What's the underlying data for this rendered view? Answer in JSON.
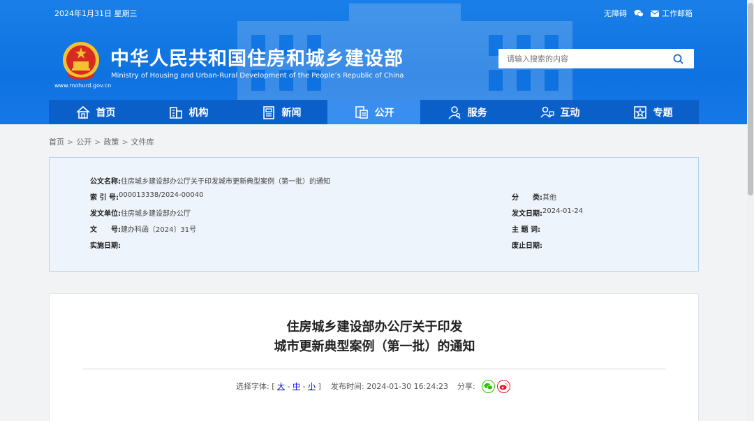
{
  "topbar": {
    "date": "2024年1月31日 星期三",
    "accessibility": "无障碍",
    "mail": "工作邮箱"
  },
  "site": {
    "title_cn": "中华人民共和国住房和城乡建设部",
    "title_en": "Ministry of Housing and Urban-Rural Development of the People’s Republic of China",
    "url": "www.mohurd.gov.cn"
  },
  "search": {
    "placeholder": "请输入搜索的内容"
  },
  "nav": [
    {
      "label": "首页",
      "icon": "home-icon"
    },
    {
      "label": "机构",
      "icon": "building-icon"
    },
    {
      "label": "新闻",
      "icon": "news-icon"
    },
    {
      "label": "公开",
      "icon": "disclosure-icon",
      "active": true
    },
    {
      "label": "服务",
      "icon": "service-icon"
    },
    {
      "label": "互动",
      "icon": "interaction-icon"
    },
    {
      "label": "专题",
      "icon": "topic-icon"
    }
  ],
  "breadcrumb": [
    "首页",
    "公开",
    "政策",
    "文件库"
  ],
  "info": {
    "name_label": "公文名称:",
    "name_value": "住房城乡建设部办公厅关于印发城市更新典型案例（第一批）的通知",
    "index_label": "索 引 号:",
    "index_value": "000013338/2024-00040",
    "category_label": "分　　类:",
    "category_value": "其他",
    "issuer_label": "发文单位:",
    "issuer_value": "住房城乡建设部办公厅",
    "issue_date_label": "发文日期:",
    "issue_date_value": "2024-01-24",
    "doc_no_label": "文　　号:",
    "doc_no_value": "建办科函〔2024〕31号",
    "subject_label": "主 题 词:",
    "subject_value": "",
    "effective_label": "实施日期:",
    "effective_value": "",
    "expiry_label": "废止日期:",
    "expiry_value": ""
  },
  "article": {
    "title_line1": "住房城乡建设部办公厅关于印发",
    "title_line2": "城市更新典型案例（第一批）的通知",
    "font_label": "选择字体:",
    "bracket_open": "[",
    "font_large": "大",
    "font_medium": "中",
    "font_small": "小",
    "bracket_close": "]",
    "dash": "-",
    "publish_label": "发布时间:",
    "publish_time": "2024-01-30 16:24:23",
    "share_label": "分享:"
  },
  "colors": {
    "header_blue": "#1a7fe8",
    "nav_blue": "#0b5fc9",
    "nav_active": "#3a8ef0",
    "wechat_green": "#2dc100",
    "weibo_red": "#e6162d"
  }
}
